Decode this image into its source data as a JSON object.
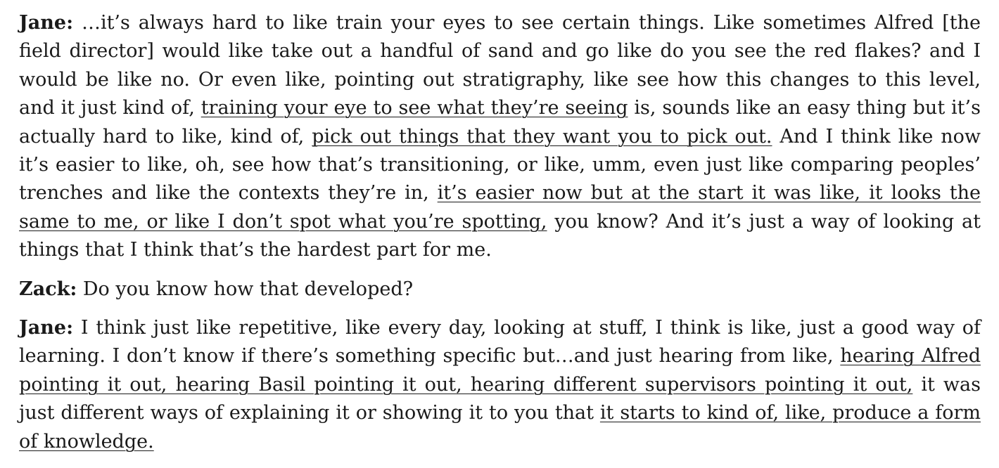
{
  "transcript": [
    {
      "speaker": "Jane:",
      "segments": [
        {
          "text": " …it’s always hard to like train your eyes to see certain things. Like sometimes Alfred [the field director] would like take out a handful of sand and go like do you see the red flakes? and I would be like no. Or even like, pointing out stratigraphy, like see how this changes to this level, and it just kind of, ",
          "underline": false
        },
        {
          "text": "training your eye to see what they’re seeing",
          "underline": true
        },
        {
          "text": " is, sounds like an easy thing but it’s actually hard to like, kind of, ",
          "underline": false
        },
        {
          "text": "pick out things that they want you to pick out.",
          "underline": true
        },
        {
          "text": " And I think like now it’s easier to like, oh, see how that’s transitioning, or like, umm, even just like comparing peoples’ trenches and like the contexts they’re in, ",
          "underline": false
        },
        {
          "text": "it’s easier now but at the start it was like, it looks the same to me, or like I don’t spot what you’re spotting,",
          "underline": true
        },
        {
          "text": " you know? And it’s just a way of looking at things that I think that’s the hardest part for me.",
          "underline": false
        }
      ]
    },
    {
      "speaker": "Zack:",
      "segments": [
        {
          "text": " Do you know how that developed?",
          "underline": false
        }
      ]
    },
    {
      "speaker": "Jane:",
      "segments": [
        {
          "text": " I think just like repetitive, like every day, looking at stuff, I think is like, just a good way of learning. I don’t know if there’s something specific but…and just hearing from like, ",
          "underline": false
        },
        {
          "text": "hearing Alfred pointing it out, hearing Basil pointing it out, hearing different supervisors pointing it out,",
          "underline": true
        },
        {
          "text": " it was just different ways of explaining it or showing it to you that ",
          "underline": false
        },
        {
          "text": "it starts to kind of, like, produce a form of knowledge.",
          "underline": true
        }
      ]
    }
  ]
}
